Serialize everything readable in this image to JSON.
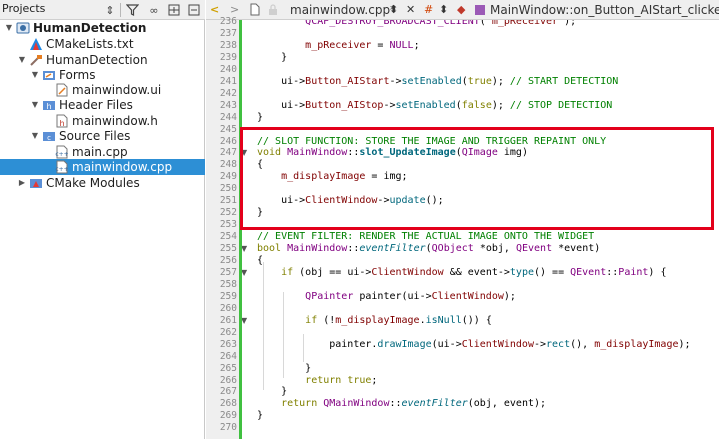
{
  "projects_pane": {
    "title": "Projects",
    "tree": [
      {
        "label": "HumanDetection",
        "bold": true,
        "icon": "project-icon",
        "arrow": "▼",
        "indent": 0
      },
      {
        "label": "CMakeLists.txt",
        "icon": "cmake-file-icon",
        "arrow": "",
        "indent": 1
      },
      {
        "label": "HumanDetection",
        "icon": "build-target-icon",
        "arrow": "▼",
        "indent": 1
      },
      {
        "label": "Forms",
        "icon": "forms-folder-icon",
        "arrow": "▼",
        "indent": 2
      },
      {
        "label": "mainwindow.ui",
        "icon": "ui-file-icon",
        "arrow": "",
        "indent": 3
      },
      {
        "label": "Header Files",
        "icon": "header-folder-icon",
        "arrow": "▼",
        "indent": 2
      },
      {
        "label": "mainwindow.h",
        "icon": "header-file-icon",
        "arrow": "",
        "indent": 3
      },
      {
        "label": "Source Files",
        "icon": "source-folder-icon",
        "arrow": "▼",
        "indent": 2
      },
      {
        "label": "main.cpp",
        "icon": "cpp-file-icon",
        "arrow": "",
        "indent": 3
      },
      {
        "label": "mainwindow.cpp",
        "icon": "cpp-file-icon",
        "arrow": "",
        "indent": 3,
        "selected": true
      },
      {
        "label": "CMake Modules",
        "icon": "cmake-modules-icon",
        "arrow": "▶",
        "indent": 1
      }
    ]
  },
  "editor_toolbar": {
    "file_name": "mainwindow.cpp*",
    "function_crumb": "MainWindow::on_Button_AIStart_clicke"
  },
  "colors": {
    "selection": "#2d8fd5",
    "highlight_box": "#e3001b",
    "change_bar": "#40c040"
  },
  "code": {
    "lines": [
      {
        "n": "236",
        "parts": [
          [
            "pl",
            "        "
          ],
          [
            "ty",
            "QCAP_DESTROY_BROADCAST_CLIENT"
          ],
          [
            "pl",
            "( "
          ],
          [
            "mb",
            "m_pReceiver"
          ],
          [
            "pl",
            " );"
          ]
        ]
      },
      {
        "n": "237",
        "parts": []
      },
      {
        "n": "238",
        "parts": [
          [
            "pl",
            "        "
          ],
          [
            "mb",
            "m_pReceiver"
          ],
          [
            "pl",
            " = "
          ],
          [
            "ty",
            "NULL"
          ],
          [
            "pl",
            ";"
          ]
        ]
      },
      {
        "n": "239",
        "parts": [
          [
            "pl",
            "    }"
          ]
        ]
      },
      {
        "n": "240",
        "parts": []
      },
      {
        "n": "241",
        "parts": [
          [
            "pl",
            "    ui->"
          ],
          [
            "mb",
            "Button_AIStart"
          ],
          [
            "pl",
            "->"
          ],
          [
            "fn",
            "setEnabled"
          ],
          [
            "pl",
            "("
          ],
          [
            "kw",
            "true"
          ],
          [
            "pl",
            "); "
          ],
          [
            "cm",
            "// START DETECTION"
          ]
        ]
      },
      {
        "n": "242",
        "parts": []
      },
      {
        "n": "243",
        "parts": [
          [
            "pl",
            "    ui->"
          ],
          [
            "mb",
            "Button_AIStop"
          ],
          [
            "pl",
            "->"
          ],
          [
            "fn",
            "setEnabled"
          ],
          [
            "pl",
            "("
          ],
          [
            "kw",
            "false"
          ],
          [
            "pl",
            "); "
          ],
          [
            "cm",
            "// STOP DETECTION"
          ]
        ]
      },
      {
        "n": "244",
        "parts": [
          [
            "pl",
            "}"
          ]
        ]
      },
      {
        "n": "245",
        "parts": []
      },
      {
        "n": "246",
        "parts": [
          [
            "cm",
            "// SLOT FUNCTION: STORE THE IMAGE AND TRIGGER REPAINT ONLY"
          ]
        ]
      },
      {
        "n": "247",
        "fold": true,
        "parts": [
          [
            "kw",
            "void"
          ],
          [
            "pl",
            " "
          ],
          [
            "ty",
            "MainWindow"
          ],
          [
            "pl",
            "::"
          ],
          [
            "bd",
            "slot_UpdateImage"
          ],
          [
            "pl",
            "("
          ],
          [
            "ty",
            "QImage"
          ],
          [
            "pl",
            " img)"
          ]
        ]
      },
      {
        "n": "248",
        "parts": [
          [
            "pl",
            "{"
          ]
        ]
      },
      {
        "n": "249",
        "parts": [
          [
            "pl",
            "    "
          ],
          [
            "mb",
            "m_displayImage"
          ],
          [
            "pl",
            " = img;"
          ]
        ]
      },
      {
        "n": "250",
        "parts": []
      },
      {
        "n": "251",
        "parts": [
          [
            "pl",
            "    ui->"
          ],
          [
            "mb",
            "ClientWindow"
          ],
          [
            "pl",
            "->"
          ],
          [
            "fn",
            "update"
          ],
          [
            "pl",
            "();"
          ]
        ]
      },
      {
        "n": "252",
        "parts": [
          [
            "pl",
            "}"
          ]
        ]
      },
      {
        "n": "253",
        "parts": []
      },
      {
        "n": "254",
        "parts": [
          [
            "cm",
            "// EVENT FILTER: RENDER THE ACTUAL IMAGE ONTO THE WIDGET"
          ]
        ]
      },
      {
        "n": "255",
        "fold": true,
        "parts": [
          [
            "kw",
            "bool"
          ],
          [
            "pl",
            " "
          ],
          [
            "ty",
            "MainWindow"
          ],
          [
            "pl",
            "::"
          ],
          [
            "ic",
            "eventFilter"
          ],
          [
            "pl",
            "("
          ],
          [
            "ty",
            "QObject"
          ],
          [
            "pl",
            " *obj, "
          ],
          [
            "ty",
            "QEvent"
          ],
          [
            "pl",
            " *event)"
          ]
        ]
      },
      {
        "n": "256",
        "parts": [
          [
            "pl",
            "{"
          ]
        ]
      },
      {
        "n": "257",
        "fold": true,
        "parts": [
          [
            "pl",
            "    "
          ],
          [
            "kw",
            "if"
          ],
          [
            "pl",
            " (obj == ui->"
          ],
          [
            "mb",
            "ClientWindow"
          ],
          [
            "pl",
            " && event->"
          ],
          [
            "fn",
            "type"
          ],
          [
            "pl",
            "() == "
          ],
          [
            "ty",
            "QEvent"
          ],
          [
            "pl",
            "::"
          ],
          [
            "ty",
            "Paint"
          ],
          [
            "pl",
            ") {"
          ]
        ]
      },
      {
        "n": "258",
        "parts": []
      },
      {
        "n": "259",
        "parts": [
          [
            "pl",
            "        "
          ],
          [
            "ty",
            "QPainter"
          ],
          [
            "pl",
            " painter(ui->"
          ],
          [
            "mb",
            "ClientWindow"
          ],
          [
            "pl",
            ");"
          ]
        ]
      },
      {
        "n": "260",
        "parts": []
      },
      {
        "n": "261",
        "fold": true,
        "parts": [
          [
            "pl",
            "        "
          ],
          [
            "kw",
            "if"
          ],
          [
            "pl",
            " (!"
          ],
          [
            "mb",
            "m_displayImage"
          ],
          [
            "pl",
            "."
          ],
          [
            "fn",
            "isNull"
          ],
          [
            "pl",
            "()) {"
          ]
        ]
      },
      {
        "n": "262",
        "parts": []
      },
      {
        "n": "263",
        "parts": [
          [
            "pl",
            "            painter."
          ],
          [
            "fn",
            "drawImage"
          ],
          [
            "pl",
            "(ui->"
          ],
          [
            "mb",
            "ClientWindow"
          ],
          [
            "pl",
            "->"
          ],
          [
            "fn",
            "rect"
          ],
          [
            "pl",
            "(), "
          ],
          [
            "mb",
            "m_displayImage"
          ],
          [
            "pl",
            ");"
          ]
        ]
      },
      {
        "n": "264",
        "parts": []
      },
      {
        "n": "265",
        "parts": [
          [
            "pl",
            "        }"
          ]
        ]
      },
      {
        "n": "266",
        "parts": [
          [
            "pl",
            "        "
          ],
          [
            "kw",
            "return"
          ],
          [
            "pl",
            " "
          ],
          [
            "kw",
            "true"
          ],
          [
            "pl",
            ";"
          ]
        ]
      },
      {
        "n": "267",
        "parts": [
          [
            "pl",
            "    }"
          ]
        ]
      },
      {
        "n": "268",
        "parts": [
          [
            "pl",
            "    "
          ],
          [
            "kw",
            "return"
          ],
          [
            "pl",
            " "
          ],
          [
            "ty",
            "QMainWindow"
          ],
          [
            "pl",
            "::"
          ],
          [
            "ic",
            "eventFilter"
          ],
          [
            "pl",
            "(obj, event);"
          ]
        ]
      },
      {
        "n": "269",
        "parts": [
          [
            "pl",
            "}"
          ]
        ]
      },
      {
        "n": "270",
        "parts": []
      }
    ]
  }
}
